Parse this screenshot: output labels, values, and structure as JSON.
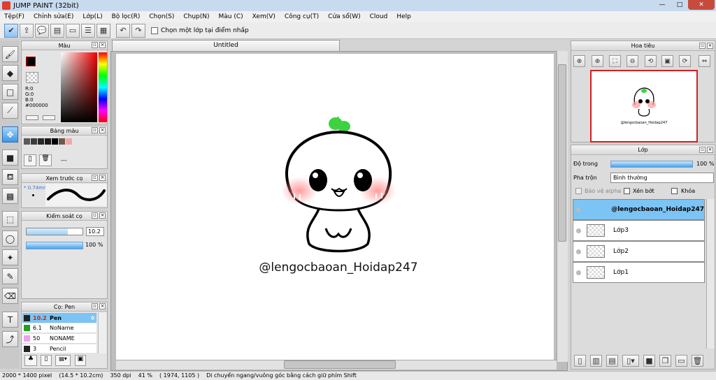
{
  "window": {
    "title": "JUMP PAINT (32bit)",
    "minimize": "—",
    "maximize": "□",
    "close": "✕"
  },
  "menu": [
    "Tệp(F)",
    "Chỉnh sửa(E)",
    "Lớp(L)",
    "Bộ lọc(R)",
    "Chọn(S)",
    "Chụp(N)",
    "Màu (C)",
    "Xem(V)",
    "Công cụ(T)",
    "Cửa sổ(W)",
    "Cloud",
    "Help"
  ],
  "toolbar": {
    "option_label": "Chọn một lớp tại điểm nhấp"
  },
  "color_panel": {
    "title": "Màu",
    "r": "R:0",
    "g": "G:0",
    "b": "B:0",
    "hex": "#000000",
    "fg_color": "#000000",
    "bg_color": "#ffffff"
  },
  "swatch_panel": {
    "title": "Bảng màu",
    "dash": "---",
    "swatches": [
      "#5a5a5a",
      "#3c3c3c",
      "#282828",
      "#1a1a1a",
      "#000000",
      "#6b5a4a",
      "#f4a6a6"
    ]
  },
  "brush_preview": {
    "title": "Xem trước cọ",
    "size": "* 0.74mm"
  },
  "brush_control": {
    "title": "Kiểm soát cọ",
    "size_value": "10.2",
    "opacity_value": "100 %",
    "size_fill": 0.74,
    "opacity_fill": 1.0
  },
  "brush_list": {
    "title": "Cọ: Pen",
    "items": [
      {
        "size": "10.2",
        "name": "Pen",
        "color": "#222222"
      },
      {
        "size": "6.1",
        "name": "NoName",
        "color": "#22a022"
      },
      {
        "size": "50",
        "name": "NONAME",
        "color": "#f0a0f0"
      },
      {
        "size": "3",
        "name": "Pencil",
        "color": "#222222"
      }
    ]
  },
  "document": {
    "tab": "Untitled",
    "watermark": "@lengocbaoan_Hoidap247"
  },
  "navigator": {
    "title": "Hoa tiêu",
    "preview_text": "@lengocbaoan_Hoidap247"
  },
  "layers_panel": {
    "title": "Lớp",
    "opacity_label": "Độ trong",
    "opacity_value": "100 %",
    "blend_label": "Pha trộn",
    "blend_value": "Bình thường",
    "protect_alpha": "Bảo vệ alpha",
    "clipping": "Xén bớt",
    "lock": "Khóa",
    "layers": [
      {
        "name": "@lengocbaoan_Hoidap247",
        "active": true
      },
      {
        "name": "Lớp3",
        "active": false
      },
      {
        "name": "Lớp2",
        "active": false
      },
      {
        "name": "Lớp1",
        "active": false
      }
    ]
  },
  "status": {
    "size": "2000 * 1400 pixel",
    "cm": "(14.5 * 10.2cm)",
    "dpi": "350 dpi",
    "zoom": "41 %",
    "coords": "( 1974, 1105 )",
    "hint": "Di chuyển ngang/vuông góc bằng cách giữ phím Shift"
  }
}
